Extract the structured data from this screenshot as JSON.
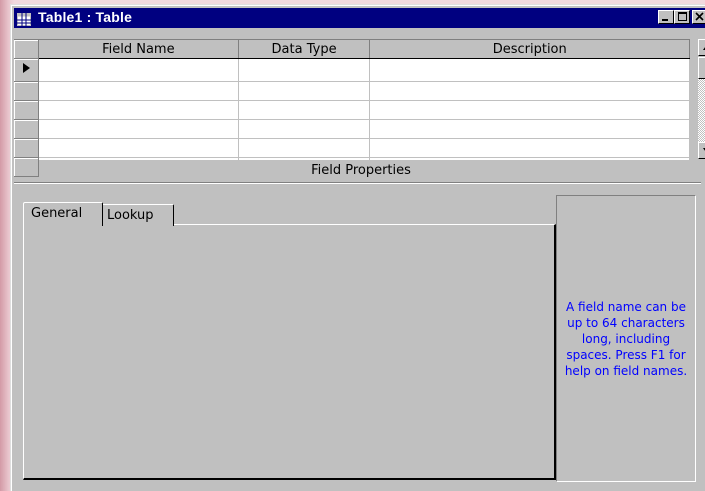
{
  "window": {
    "title": "Table1 : Table"
  },
  "grid": {
    "columns": [
      {
        "label": "Field Name"
      },
      {
        "label": "Data Type"
      },
      {
        "label": "Description"
      }
    ],
    "rows": 6,
    "current_row_indicator": "play-arrow"
  },
  "field_properties": {
    "label": "Field Properties",
    "tabs": [
      {
        "label": "General",
        "selected": true
      },
      {
        "label": "Lookup",
        "selected": false
      }
    ],
    "help_text": "A field name can be up to 64 characters long, including spaces. Press F1 for help on field names."
  },
  "colors": {
    "title_bar": "#000080",
    "face": "#c0c0c0",
    "help_text": "#0000ff"
  },
  "icons": [
    "table-icon",
    "minimize-icon",
    "maximize-icon",
    "close-icon",
    "scroll-up-icon",
    "scroll-down-icon",
    "record-selector-icon"
  ]
}
